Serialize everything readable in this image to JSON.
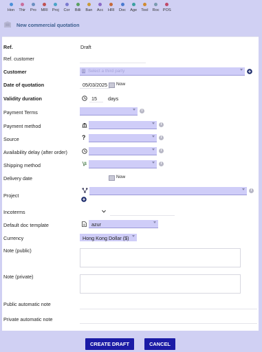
{
  "nav": {
    "items": [
      {
        "label": "Hon",
        "color": "#4a90d9"
      },
      {
        "label": "Thir",
        "color": "#c96e9c"
      },
      {
        "label": "Pro",
        "color": "#6b8fc0"
      },
      {
        "label": "MRI",
        "color": "#c05050"
      },
      {
        "label": "Proj",
        "color": "#4aa3c7"
      },
      {
        "label": "Cor",
        "color": "#7a7ad0"
      },
      {
        "label": "Billi",
        "color": "#5aa060"
      },
      {
        "label": "Ban",
        "color": "#c79a3a"
      },
      {
        "label": "Acc",
        "color": "#8a6ac7"
      },
      {
        "label": "HRI",
        "color": "#c56a3a"
      },
      {
        "label": "Doc",
        "color": "#4a7ad0"
      },
      {
        "label": "Age",
        "color": "#3aa0a0"
      },
      {
        "label": "Tool",
        "color": "#d08a30"
      },
      {
        "label": "Roc",
        "color": "#7a9ab0"
      },
      {
        "label": "POS",
        "color": "#c04a6a"
      }
    ]
  },
  "page": {
    "title": "New commercial quotation"
  },
  "form": {
    "ref_label": "Ref.",
    "ref_value": "Draft",
    "ref_customer_label": "Ref. customer",
    "customer_label": "Customer",
    "customer_placeholder": "Select a third party",
    "date_label": "Date of quotation",
    "date_value": "05/03/2025",
    "now_label": "Now",
    "validity_label": "Validity duration",
    "validity_value": "15",
    "validity_unit": "days",
    "payment_terms_label": "Payment Terms",
    "payment_method_label": "Payment method",
    "source_label": "Source",
    "availability_label": "Availability delay (after order)",
    "shipping_label": "Shipping method",
    "delivery_label": "Delivery date",
    "delivery_now_label": "Now",
    "project_label": "Project",
    "incoterms_label": "Incoterms",
    "doc_template_label": "Default doc template",
    "doc_template_value": "azur",
    "currency_label": "Currency",
    "currency_value": "Hong Kong Dollar ($)",
    "note_public_label": "Note (public)",
    "note_private_label": "Note (private)",
    "public_auto_note_label": "Public automatic note",
    "private_auto_note_label": "Private automatic note"
  },
  "actions": {
    "create_label": "CREATE DRAFT",
    "cancel_label": "CANCEL"
  }
}
